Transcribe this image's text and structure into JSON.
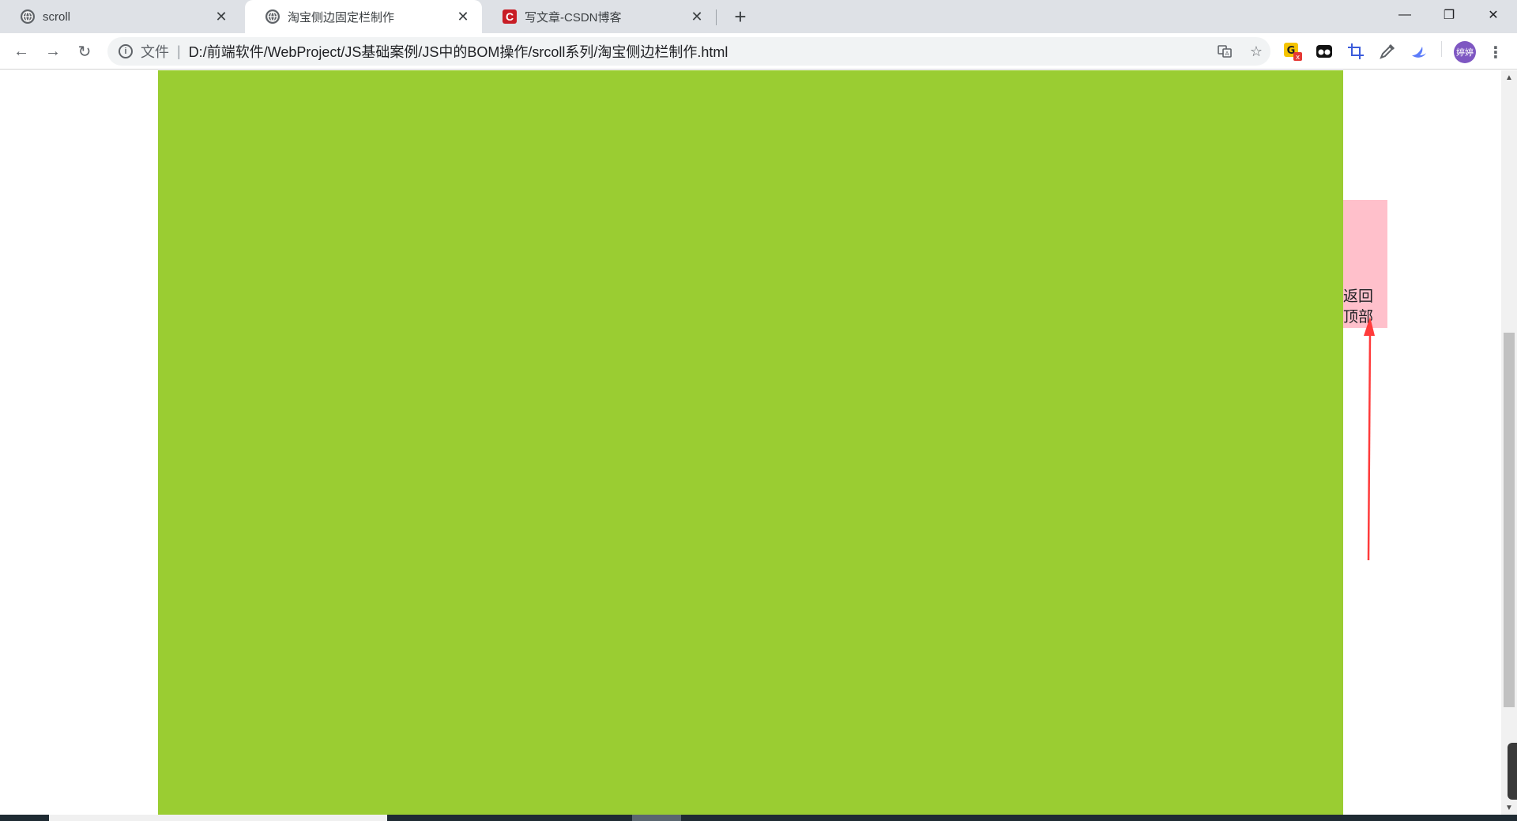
{
  "tabs": [
    {
      "title": "scroll",
      "icon": "globe-icon",
      "active": false
    },
    {
      "title": "淘宝侧边固定栏制作",
      "icon": "globe-icon",
      "active": true
    },
    {
      "title": "写文章-CSDN博客",
      "icon": "csdn-icon",
      "active": false
    }
  ],
  "toolbar": {
    "scheme_label": "文件",
    "url": "D:/前端软件/WebProject/JS基础案例/JS中的BOM操作/srcoll系列/淘宝侧边栏制作.html",
    "avatar_text": "婷婷"
  },
  "page": {
    "sidebar_label_line1": "返回",
    "sidebar_label_line2": "顶部"
  },
  "colors": {
    "green_block": "#9acd32",
    "sidebar": "#ffc0cb",
    "arrow": "#ff3b3b"
  }
}
